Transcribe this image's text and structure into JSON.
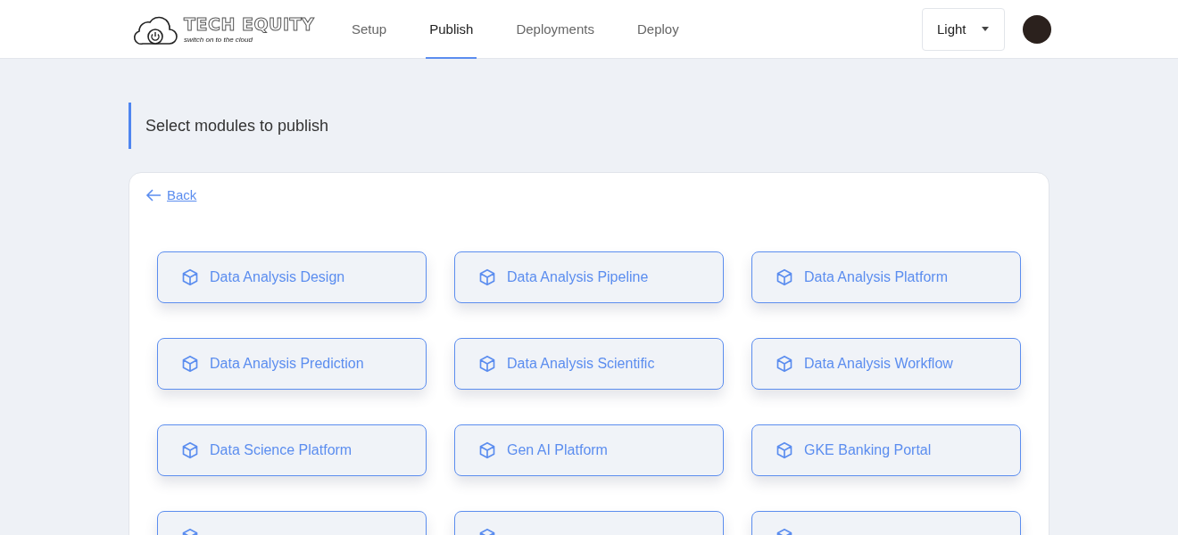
{
  "header": {
    "logo": {
      "title": "TECH EQUITY",
      "tagline": "switch on to the cloud"
    },
    "nav": [
      {
        "label": "Setup",
        "selected": false
      },
      {
        "label": "Publish",
        "selected": true
      },
      {
        "label": "Deployments",
        "selected": false
      },
      {
        "label": "Deploy",
        "selected": false
      }
    ],
    "theme_select": {
      "value": "Light"
    }
  },
  "page_title": "Select modules to publish",
  "back_link": "Back",
  "modules": [
    {
      "label": "Data Analysis Design"
    },
    {
      "label": "Data Analysis Pipeline"
    },
    {
      "label": "Data Analysis Platform"
    },
    {
      "label": "Data Analysis Prediction"
    },
    {
      "label": "Data Analysis Scientific"
    },
    {
      "label": "Data Analysis Workflow"
    },
    {
      "label": "Data Science Platform"
    },
    {
      "label": "Gen AI Platform"
    },
    {
      "label": "GKE Banking Portal"
    }
  ],
  "more_modules_below": true
}
